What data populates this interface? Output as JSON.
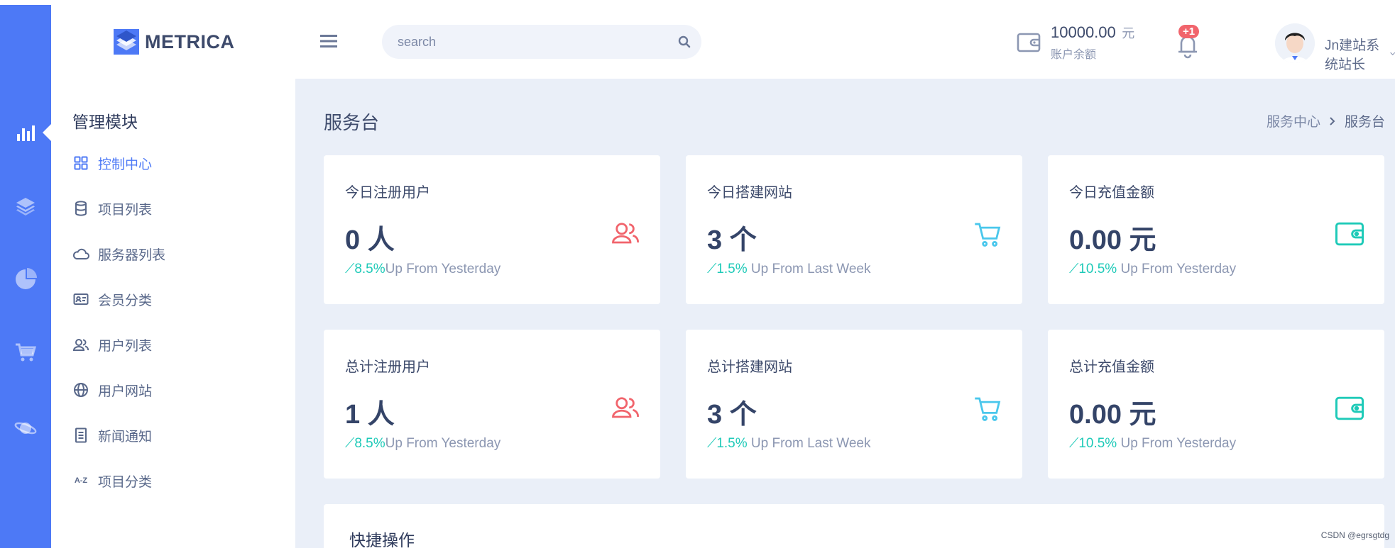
{
  "logo": {
    "text": "METRICA"
  },
  "search": {
    "placeholder": "search"
  },
  "wallet": {
    "amount": "10000.00",
    "unit": "元",
    "label": "账户余额"
  },
  "notifications": {
    "badge": "+1"
  },
  "user": {
    "name": "Jn建站系统站长"
  },
  "rail": {
    "items": [
      {
        "icon": "bar-chart-icon",
        "active": true
      },
      {
        "icon": "layers-icon",
        "active": false
      },
      {
        "icon": "pie-chart-icon",
        "active": false
      },
      {
        "icon": "cart-icon",
        "active": false
      },
      {
        "icon": "planet-icon",
        "active": false
      }
    ]
  },
  "sidebar": {
    "title": "管理模块",
    "items": [
      {
        "label": "控制中心",
        "icon": "grid-icon",
        "active": true
      },
      {
        "label": "项目列表",
        "icon": "database-icon",
        "active": false
      },
      {
        "label": "服务器列表",
        "icon": "cloud-icon",
        "active": false
      },
      {
        "label": "会员分类",
        "icon": "id-card-icon",
        "active": false
      },
      {
        "label": "用户列表",
        "icon": "users-icon",
        "active": false
      },
      {
        "label": "用户网站",
        "icon": "globe-icon",
        "active": false
      },
      {
        "label": "新闻通知",
        "icon": "document-icon",
        "active": false
      },
      {
        "label": "项目分类",
        "icon": "sort-az-icon",
        "icon_text": "A-Z",
        "active": false
      }
    ]
  },
  "page": {
    "title": "服务台",
    "breadcrumb": [
      "服务中心",
      "服务台"
    ]
  },
  "cards": [
    {
      "label": "今日注册用户",
      "value": "0 人",
      "trend_value": "8.5%",
      "trend_text": "Up From Yesterday",
      "icon": "users-icon",
      "icon_color": "#f1646c"
    },
    {
      "label": "今日搭建网站",
      "value": "3 个",
      "trend_value": "1.5%",
      "trend_text": " Up From Last Week",
      "icon": "cart-icon",
      "icon_color": "#4ac7ec"
    },
    {
      "label": "今日充值金额",
      "value": "0.00 元",
      "trend_value": "10.5%",
      "trend_text": " Up From Yesterday",
      "icon": "wallet-icon",
      "icon_color": "#1ecab8"
    },
    {
      "label": "总计注册用户",
      "value": "1 人",
      "trend_value": "8.5%",
      "trend_text": "Up From Yesterday",
      "icon": "users-icon",
      "icon_color": "#f1646c"
    },
    {
      "label": "总计搭建网站",
      "value": "3 个",
      "trend_value": "1.5%",
      "trend_text": " Up From Last Week",
      "icon": "cart-icon",
      "icon_color": "#4ac7ec"
    },
    {
      "label": "总计充值金额",
      "value": "0.00 元",
      "trend_value": "10.5%",
      "trend_text": " Up From Yesterday",
      "icon": "wallet-icon",
      "icon_color": "#1ecab8"
    }
  ],
  "quick_actions": {
    "title": "快捷操作"
  },
  "watermark": "CSDN @egrsgtdg",
  "colors": {
    "primary": "#4d79f6",
    "success": "#1ecab8",
    "danger": "#f1646c",
    "info": "#4ac7ec"
  }
}
